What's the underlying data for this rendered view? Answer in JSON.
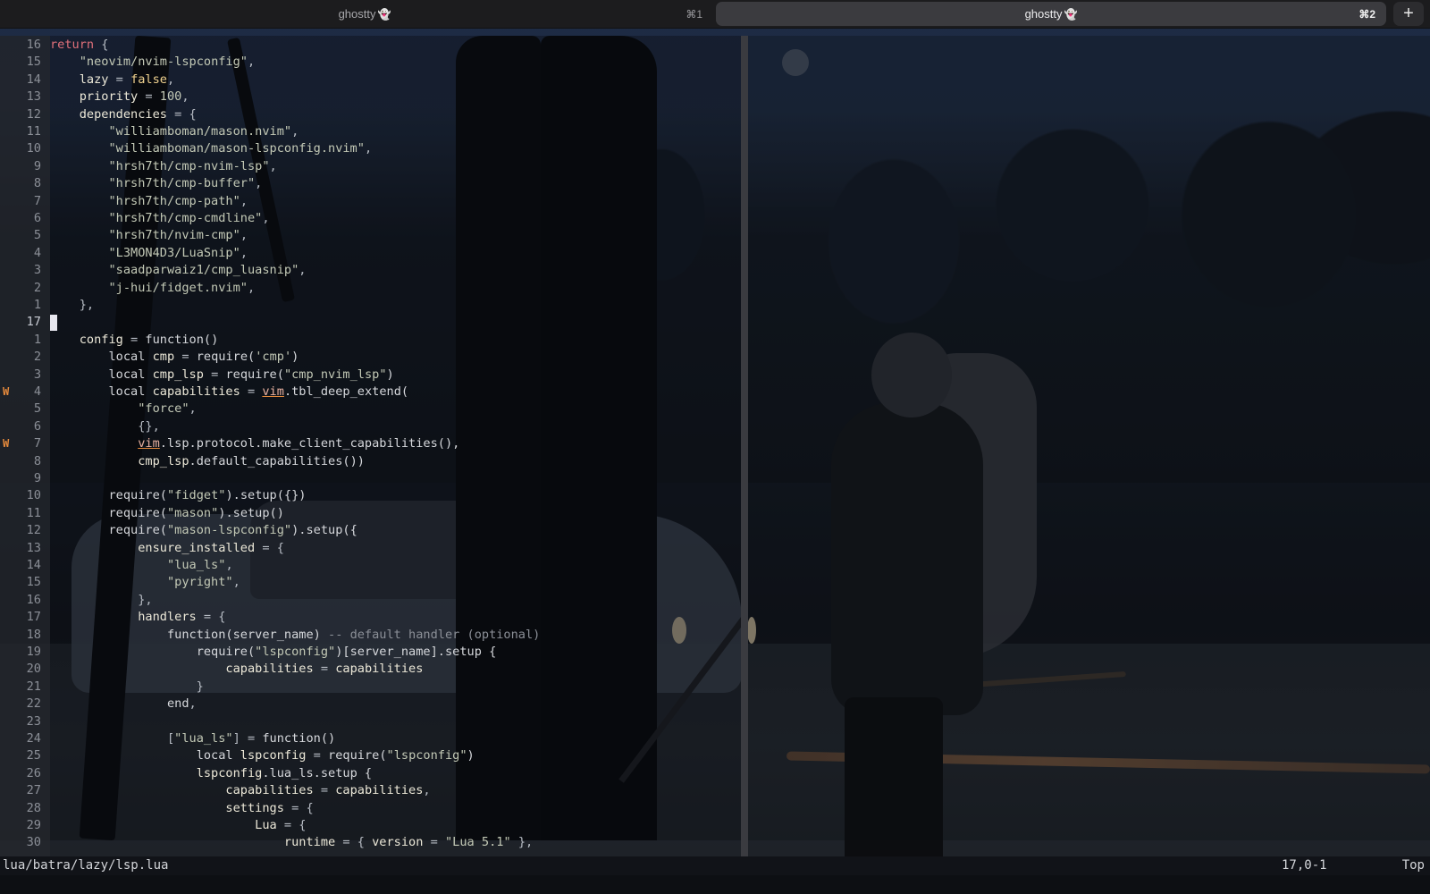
{
  "tabs": [
    {
      "title": "ghostty",
      "emoji": "👻",
      "shortcut": "⌘1",
      "active": false
    },
    {
      "title": "ghostty",
      "emoji": "👻",
      "shortcut": "⌘2",
      "active": true
    }
  ],
  "new_tab_label": "+",
  "editor": {
    "lines": [
      {
        "num": "16",
        "code": [
          [
            "k",
            "return"
          ],
          [
            "op",
            " {"
          ]
        ]
      },
      {
        "num": "15",
        "code": [
          [
            "op",
            "    "
          ],
          [
            "s",
            "\"neovim/nvim-lspconfig\""
          ],
          [
            "op",
            ","
          ]
        ]
      },
      {
        "num": "14",
        "code": [
          [
            "op",
            "    "
          ],
          [
            "id",
            "lazy"
          ],
          [
            "op",
            " = "
          ],
          [
            "b",
            "false"
          ],
          [
            "op",
            ","
          ]
        ]
      },
      {
        "num": "13",
        "code": [
          [
            "op",
            "    "
          ],
          [
            "id",
            "priority"
          ],
          [
            "op",
            " = "
          ],
          [
            "num",
            "100"
          ],
          [
            "op",
            ","
          ]
        ]
      },
      {
        "num": "12",
        "code": [
          [
            "op",
            "    "
          ],
          [
            "id",
            "dependencies"
          ],
          [
            "op",
            " = {"
          ]
        ]
      },
      {
        "num": "11",
        "code": [
          [
            "op",
            "        "
          ],
          [
            "s",
            "\"williamboman/mason.nvim\""
          ],
          [
            "op",
            ","
          ]
        ]
      },
      {
        "num": "10",
        "code": [
          [
            "op",
            "        "
          ],
          [
            "s",
            "\"williamboman/mason-lspconfig.nvim\""
          ],
          [
            "op",
            ","
          ]
        ]
      },
      {
        "num": "9",
        "code": [
          [
            "op",
            "        "
          ],
          [
            "s",
            "\"hrsh7th/cmp-nvim-lsp\""
          ],
          [
            "op",
            ","
          ]
        ]
      },
      {
        "num": "8",
        "code": [
          [
            "op",
            "        "
          ],
          [
            "s",
            "\"hrsh7th/cmp-buffer\""
          ],
          [
            "op",
            ","
          ]
        ]
      },
      {
        "num": "7",
        "code": [
          [
            "op",
            "        "
          ],
          [
            "s",
            "\"hrsh7th/cmp-path\""
          ],
          [
            "op",
            ","
          ]
        ]
      },
      {
        "num": "6",
        "code": [
          [
            "op",
            "        "
          ],
          [
            "s",
            "\"hrsh7th/cmp-cmdline\""
          ],
          [
            "op",
            ","
          ]
        ]
      },
      {
        "num": "5",
        "code": [
          [
            "op",
            "        "
          ],
          [
            "s",
            "\"hrsh7th/nvim-cmp\""
          ],
          [
            "op",
            ","
          ]
        ]
      },
      {
        "num": "4",
        "code": [
          [
            "op",
            "        "
          ],
          [
            "s",
            "\"L3MON4D3/LuaSnip\""
          ],
          [
            "op",
            ","
          ]
        ]
      },
      {
        "num": "3",
        "code": [
          [
            "op",
            "        "
          ],
          [
            "s",
            "\"saadparwaiz1/cmp_luasnip\""
          ],
          [
            "op",
            ","
          ]
        ]
      },
      {
        "num": "2",
        "code": [
          [
            "op",
            "        "
          ],
          [
            "s",
            "\"j-hui/fidget.nvim\""
          ],
          [
            "op",
            ","
          ]
        ]
      },
      {
        "num": "1",
        "code": [
          [
            "op",
            "    },"
          ]
        ]
      },
      {
        "num": "17",
        "current": true,
        "code": []
      },
      {
        "num": "1",
        "code": [
          [
            "op",
            "    "
          ],
          [
            "id",
            "config"
          ],
          [
            "op",
            " = "
          ],
          [
            "fn",
            "function()"
          ]
        ]
      },
      {
        "num": "2",
        "code": [
          [
            "op",
            "        "
          ],
          [
            "fn",
            "local "
          ],
          [
            "id",
            "cmp"
          ],
          [
            "op",
            " = "
          ],
          [
            "fn",
            "require("
          ],
          [
            "s",
            "'cmp'"
          ],
          [
            "fn",
            ")"
          ]
        ]
      },
      {
        "num": "3",
        "code": [
          [
            "op",
            "        "
          ],
          [
            "fn",
            "local "
          ],
          [
            "id",
            "cmp_lsp"
          ],
          [
            "op",
            " = "
          ],
          [
            "fn",
            "require("
          ],
          [
            "s",
            "\"cmp_nvim_lsp\""
          ],
          [
            "fn",
            ")"
          ]
        ]
      },
      {
        "num": "4",
        "sign": "W",
        "code": [
          [
            "op",
            "        "
          ],
          [
            "fn",
            "local "
          ],
          [
            "id",
            "capabilities"
          ],
          [
            "op",
            " = "
          ],
          [
            "warn",
            "vim"
          ],
          [
            "fn",
            ".tbl_deep_extend("
          ]
        ]
      },
      {
        "num": "5",
        "code": [
          [
            "op",
            "            "
          ],
          [
            "s",
            "\"force\""
          ],
          [
            "op",
            ","
          ]
        ]
      },
      {
        "num": "6",
        "code": [
          [
            "op",
            "            {},"
          ]
        ]
      },
      {
        "num": "7",
        "sign": "W",
        "code": [
          [
            "op",
            "            "
          ],
          [
            "warn",
            "vim"
          ],
          [
            "fn",
            ".lsp.protocol.make_client_capabilities(),"
          ]
        ]
      },
      {
        "num": "8",
        "code": [
          [
            "op",
            "            "
          ],
          [
            "id",
            "cmp_lsp"
          ],
          [
            "fn",
            ".default_capabilities())"
          ]
        ]
      },
      {
        "num": "9",
        "code": []
      },
      {
        "num": "10",
        "code": [
          [
            "op",
            "        "
          ],
          [
            "fn",
            "require("
          ],
          [
            "s",
            "\"fidget\""
          ],
          [
            "fn",
            ").setup({})"
          ]
        ]
      },
      {
        "num": "11",
        "code": [
          [
            "op",
            "        "
          ],
          [
            "fn",
            "require("
          ],
          [
            "s",
            "\"mason\""
          ],
          [
            "fn",
            ").setup()"
          ]
        ]
      },
      {
        "num": "12",
        "code": [
          [
            "op",
            "        "
          ],
          [
            "fn",
            "require("
          ],
          [
            "s",
            "\"mason-lspconfig\""
          ],
          [
            "fn",
            ").setup({"
          ]
        ]
      },
      {
        "num": "13",
        "code": [
          [
            "op",
            "            "
          ],
          [
            "id",
            "ensure_installed"
          ],
          [
            "op",
            " = {"
          ]
        ]
      },
      {
        "num": "14",
        "code": [
          [
            "op",
            "                "
          ],
          [
            "s",
            "\"lua_ls\""
          ],
          [
            "op",
            ","
          ]
        ]
      },
      {
        "num": "15",
        "code": [
          [
            "op",
            "                "
          ],
          [
            "s",
            "\"pyright\""
          ],
          [
            "op",
            ","
          ]
        ]
      },
      {
        "num": "16",
        "code": [
          [
            "op",
            "            },"
          ]
        ]
      },
      {
        "num": "17",
        "code": [
          [
            "op",
            "            "
          ],
          [
            "id",
            "handlers"
          ],
          [
            "op",
            " = {"
          ]
        ]
      },
      {
        "num": "18",
        "code": [
          [
            "op",
            "                "
          ],
          [
            "fn",
            "function(server_name)"
          ],
          [
            "cm",
            " -- default handler (optional)"
          ]
        ]
      },
      {
        "num": "19",
        "code": [
          [
            "op",
            "                    "
          ],
          [
            "fn",
            "require("
          ],
          [
            "s",
            "\"lspconfig\""
          ],
          [
            "fn",
            ")[server_name].setup {"
          ]
        ]
      },
      {
        "num": "20",
        "code": [
          [
            "op",
            "                        "
          ],
          [
            "id",
            "capabilities"
          ],
          [
            "op",
            " = "
          ],
          [
            "id",
            "capabilities"
          ]
        ]
      },
      {
        "num": "21",
        "code": [
          [
            "op",
            "                    }"
          ]
        ]
      },
      {
        "num": "22",
        "code": [
          [
            "op",
            "                "
          ],
          [
            "fn",
            "end"
          ],
          [
            "op",
            ","
          ]
        ]
      },
      {
        "num": "23",
        "code": []
      },
      {
        "num": "24",
        "code": [
          [
            "op",
            "                ["
          ],
          [
            "s",
            "\"lua_ls\""
          ],
          [
            "op",
            "] = "
          ],
          [
            "fn",
            "function()"
          ]
        ]
      },
      {
        "num": "25",
        "code": [
          [
            "op",
            "                    "
          ],
          [
            "fn",
            "local "
          ],
          [
            "id",
            "lspconfig"
          ],
          [
            "op",
            " = "
          ],
          [
            "fn",
            "require("
          ],
          [
            "s",
            "\"lspconfig\""
          ],
          [
            "fn",
            ")"
          ]
        ]
      },
      {
        "num": "26",
        "code": [
          [
            "op",
            "                    "
          ],
          [
            "id",
            "lspconfig"
          ],
          [
            "fn",
            ".lua_ls.setup {"
          ]
        ]
      },
      {
        "num": "27",
        "code": [
          [
            "op",
            "                        "
          ],
          [
            "id",
            "capabilities"
          ],
          [
            "op",
            " = "
          ],
          [
            "id",
            "capabilities"
          ],
          [
            "op",
            ","
          ]
        ]
      },
      {
        "num": "28",
        "code": [
          [
            "op",
            "                        "
          ],
          [
            "id",
            "settings"
          ],
          [
            "op",
            " = {"
          ]
        ]
      },
      {
        "num": "29",
        "code": [
          [
            "op",
            "                            "
          ],
          [
            "id",
            "Lua"
          ],
          [
            "op",
            " = {"
          ]
        ]
      },
      {
        "num": "30",
        "code": [
          [
            "op",
            "                                "
          ],
          [
            "id",
            "runtime"
          ],
          [
            "op",
            " = { "
          ],
          [
            "id",
            "version"
          ],
          [
            "op",
            " = "
          ],
          [
            "s",
            "\"Lua 5.1\""
          ],
          [
            "op",
            " },"
          ]
        ]
      }
    ]
  },
  "statusline": {
    "file": "lua/batra/lazy/lsp.lua",
    "position": "17,0-1",
    "scroll": "Top"
  }
}
